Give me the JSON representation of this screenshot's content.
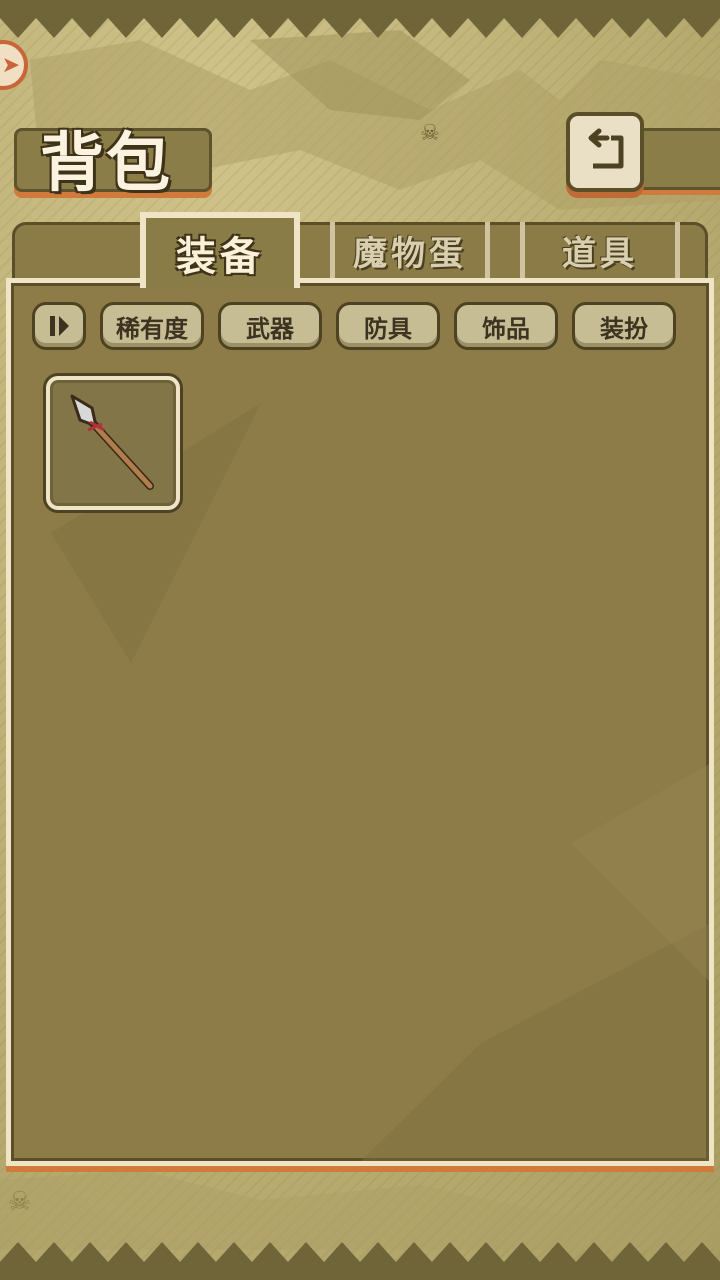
{
  "header": {
    "title": "背包",
    "back_icon": "back-arrow-icon",
    "corner_icon": "arrow-right-icon"
  },
  "tabs": [
    {
      "label": "装备",
      "active": true
    },
    {
      "label": "魔物蛋",
      "active": false
    },
    {
      "label": "道具",
      "active": false
    }
  ],
  "filters": {
    "sort_icon": "sort-toggle-icon",
    "buttons": [
      "稀有度",
      "武器",
      "防具",
      "饰品",
      "装扮"
    ]
  },
  "inventory": {
    "items": [
      {
        "name_icon": "spear-icon"
      }
    ]
  },
  "colors": {
    "panel": "#8d7c48",
    "border_light": "#efe5c6",
    "accent_orange": "#d07a3c",
    "dark_outline": "#4d4322"
  }
}
